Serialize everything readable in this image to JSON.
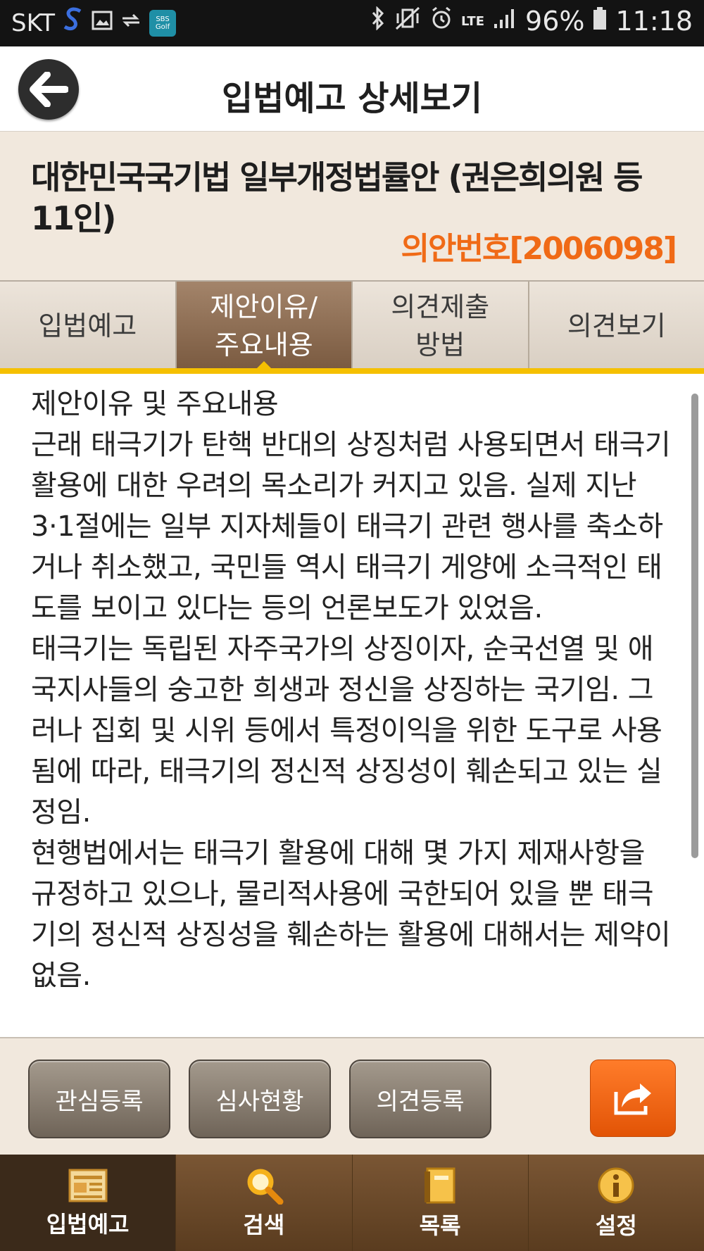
{
  "status_bar": {
    "carrier": "SKT",
    "sbs_badge_line1": "SBS",
    "sbs_badge_line2": "Golf",
    "network": "LTE",
    "battery": "96%",
    "time": "11:18"
  },
  "header": {
    "title": "입법예고 상세보기"
  },
  "bill": {
    "title": "대한민국국기법 일부개정법률안 (권은희의원 등 11인)",
    "number": "의안번호[2006098]"
  },
  "tabs": [
    {
      "label": "입법예고"
    },
    {
      "label": "제안이유/\n주요내용"
    },
    {
      "label": "의견제출\n방법"
    },
    {
      "label": "의견보기"
    }
  ],
  "content": {
    "heading": "제안이유 및 주요내용",
    "paragraphs": [
      "근래 태극기가 탄핵 반대의 상징처럼 사용되면서 태극기 활용에 대한 우려의 목소리가 커지고 있음. 실제 지난 3·1절에는 일부 지자체들이 태극기 관련 행사를 축소하거나 취소했고, 국민들 역시 태극기 게양에 소극적인 태도를 보이고 있다는 등의 언론보도가 있었음.",
      "태극기는 독립된 자주국가의 상징이자, 순국선열 및 애국지사들의 숭고한 희생과 정신을 상징하는 국기임. 그러나 집회 및 시위 등에서 특정이익을 위한 도구로 사용됨에 따라, 태극기의 정신적 상징성이 훼손되고 있는 실정임.",
      "현행법에서는 태극기 활용에 대해 몇 가지 제재사항을 규정하고 있으나, 물리적사용에 국한되어 있을 뿐 태극기의 정신적 상징성을 훼손하는 활용에 대해서는 제약이 없음."
    ]
  },
  "actions": {
    "interest": "관심등록",
    "review": "심사현황",
    "opinion": "의견등록"
  },
  "bottom_nav": [
    {
      "label": "입법예고",
      "icon": "document-icon"
    },
    {
      "label": "검색",
      "icon": "search-icon"
    },
    {
      "label": "목록",
      "icon": "book-icon"
    },
    {
      "label": "설정",
      "icon": "info-icon"
    }
  ],
  "colors": {
    "accent_orange": "#f06a16",
    "tab_active": "#7a5a40",
    "tab_underline": "#f5c000",
    "nav_bg": "#6b4a2a"
  }
}
